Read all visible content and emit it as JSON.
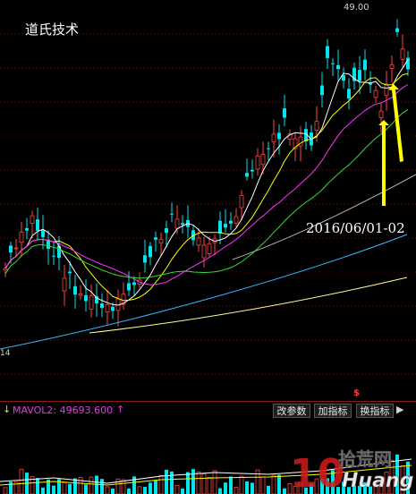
{
  "chart": {
    "title": "道氏技术",
    "price_max_label": "49.00",
    "price_min_label": "14",
    "annotation": "2016/06/01-02"
  },
  "volume_bar": {
    "down_arrow": "↓",
    "indicator_text": "MAVOL2: 49693.600",
    "up_arrow": "↑",
    "signal_mark": "$",
    "buttons": [
      "改参数",
      "加指标",
      "换指标"
    ],
    "nav_arrow": "▶"
  },
  "watermark": {
    "number": "10",
    "brand_cn": "拾荒网",
    "brand_en": "Huang"
  },
  "colors": {
    "up_candle": "#ff4444",
    "down_candle": "#00e5ee",
    "ma5": "#ffffff",
    "ma10": "#ffff00",
    "ma20": "#ff33ff",
    "ma30": "#33dd33",
    "ma60": "#aaaaaa",
    "ma120": "#33bbff",
    "ma250": "#ffff99",
    "arrow_annotation": "#ffff00"
  }
}
